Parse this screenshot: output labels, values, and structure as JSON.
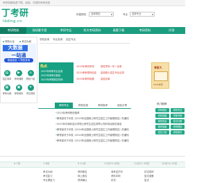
{
  "topbar": {
    "text": "考研真题免费下载、经验、可视的考研信息"
  },
  "logo": {
    "text": "丁考研",
    "subtitle": "ldding.cn"
  },
  "search": {
    "school_label": "所属院校",
    "school_value": "选择院校",
    "major_label": "专业",
    "major_value": "选择专业"
  },
  "nav": {
    "items": [
      "考研院校",
      "保研夏令营",
      "考研专业",
      "科大考研资料",
      "真题下载",
      "考研资料",
      "问答"
    ]
  },
  "left_menu": {
    "items": [
      "院校大全",
      "考试大纲",
      "考研经验",
      "专业介绍"
    ]
  },
  "banner": {
    "line1": "大数据",
    "line2": "一站通",
    "line3": "数量信息 → 院校查询"
  },
  "icon_grid": {
    "items": [
      "招生简章",
      "考研课程",
      "院校介绍",
      "考研大纲",
      "考研资料",
      "学业规划"
    ]
  },
  "search_tabs": {
    "items": [
      "学校查询",
      "专业查询",
      "招生专业"
    ]
  },
  "hot": {
    "tag": "热点",
    "lines": [
      "2025年考研专业目录",
      "2025年考研分数线",
      "2025年考研报名时间"
    ]
  },
  "red_list": {
    "lines": [
      "2025年考研学校",
      "首发学校一年一目录",
      "2025考研调剂信息",
      "高校硕士招生专业目录",
      "2025年考研真题",
      "高校名单"
    ]
  },
  "content_tabs": {
    "items": [
      "考研专业",
      "院校信息",
      "考研报考",
      "经验分享"
    ]
  },
  "news": {
    "lines": [
      "2025年考研院校推荐",
      "教育部关于印发《2025年全国硕士研究生招生工作管理规定》的通知",
      "2025年华南科技大学硕士研究生招生简章公布时间及相关事宜",
      "教育部关于印发《2024年全国硕士研究生招生工作管理规定》的通知",
      "教育部关于印发《2024年全国硕士研究生招生工作管理规定》的通知",
      "教育部关于印发《2023年全国硕士研究生招生工作管理规定》的通知"
    ]
  },
  "poster": {
    "title": "考研大",
    "caption": "2025考研"
  },
  "right_col": {
    "heading": "热门推荐",
    "pills": [
      "考研院校",
      "考研专业",
      "考研真题",
      "学硕专硕",
      "调剂信息",
      "复试分数",
      "报考指南",
      "考研院校",
      "招生计划",
      "考研资讯"
    ]
  },
  "timeline": {
    "months": [
      "4-7月",
      "7-8月",
      "9-11月",
      "11月15-16日",
      "11月17-18日",
      "12月14-15日"
    ],
    "items": [
      [
        "考试大纲",
        "考试复习",
        "专业课复习"
      ],
      [
        "考研报名",
        "网上报名",
        "现场确认"
      ],
      [
        "准考证打印",
        "考前冲刺",
        "初试"
      ],
      [
        "初试成绩",
        "复试准备",
        "复试"
      ]
    ]
  }
}
